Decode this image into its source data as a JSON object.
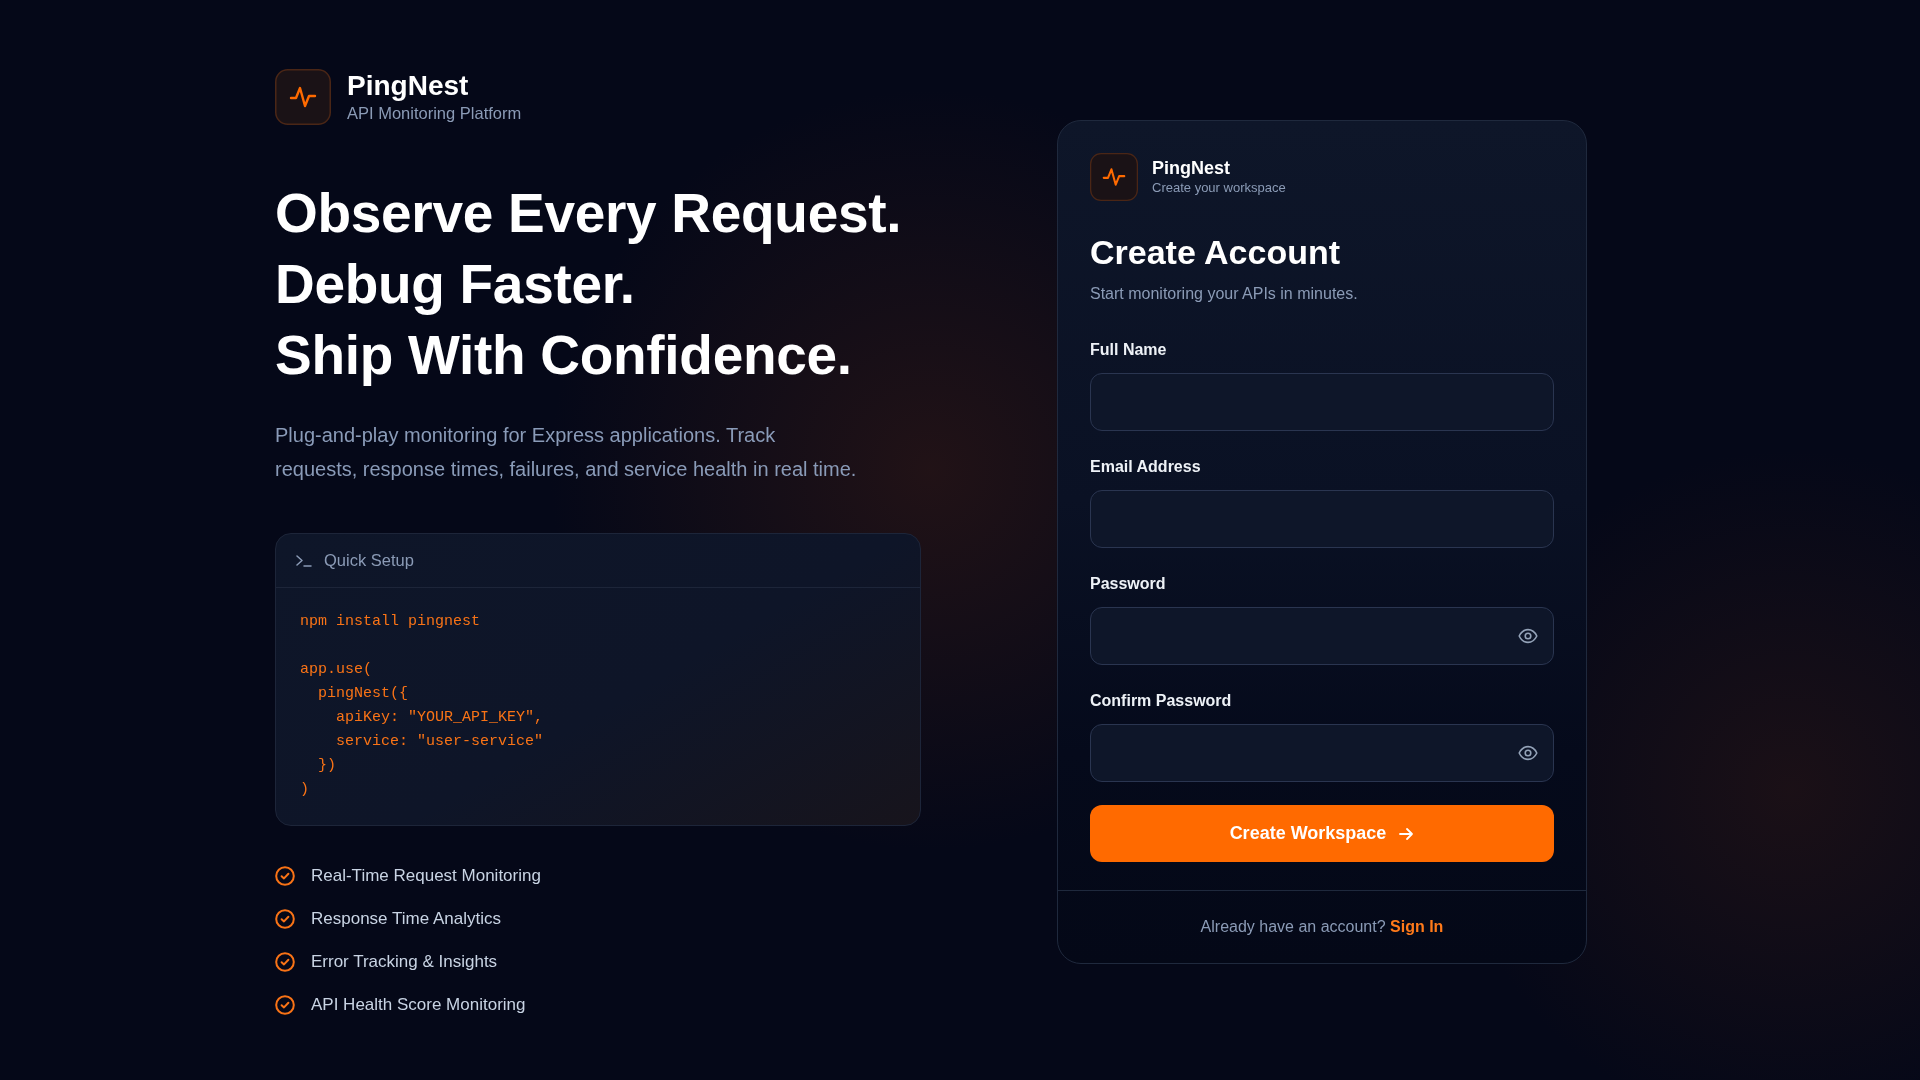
{
  "brand": {
    "name": "PingNest",
    "tagline": "API Monitoring Platform"
  },
  "hero": {
    "headline": [
      "Observe Every Request.",
      "Debug Faster.",
      "Ship With Confidence."
    ],
    "description": "Plug-and-play monitoring for Express applications. Track requests, response times, failures, and service health in real time."
  },
  "quick_setup": {
    "title": "Quick Setup",
    "code_blocks": [
      [
        "npm install pingnest"
      ],
      [
        "app.use(",
        "  pingNest({",
        "    apiKey: \"YOUR_API_KEY\",",
        "    service: \"user-service\"",
        "  })",
        ")"
      ]
    ]
  },
  "features": [
    "Real-Time Request Monitoring",
    "Response Time Analytics",
    "Error Tracking & Insights",
    "API Health Score Monitoring"
  ],
  "signup_card": {
    "brand": {
      "name": "PingNest",
      "tagline": "Create your workspace"
    },
    "title": "Create Account",
    "subtitle": "Start monitoring your APIs in minutes.",
    "fields": [
      {
        "label": "Full Name",
        "kind": "text"
      },
      {
        "label": "Email Address",
        "kind": "text"
      },
      {
        "label": "Password",
        "kind": "password"
      },
      {
        "label": "Confirm Password",
        "kind": "password"
      }
    ],
    "submit_button": "Create Workspace",
    "footer": {
      "prompt": "Already have an account?",
      "link": "Sign In"
    }
  }
}
